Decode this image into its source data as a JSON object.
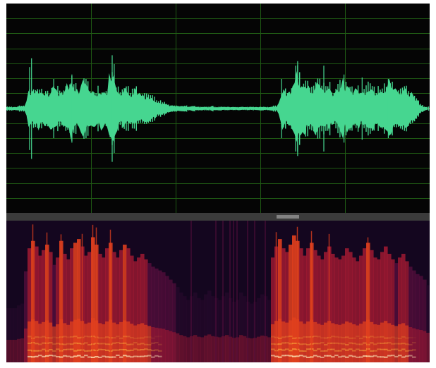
{
  "waveform": {
    "background_color": "#050505",
    "grid_color": "#1f5a14",
    "wave_color": "#46d690",
    "baseline_color": "#c8574a",
    "grid": true,
    "vertical_grid_divisions": 5,
    "horizontal_grid_divisions": 13,
    "envelope": [
      0.02,
      0.02,
      0.02,
      0.02,
      0.02,
      0.02,
      0.03,
      0.03,
      0.03,
      0.03,
      0.12,
      0.2,
      0.22,
      0.2,
      0.21,
      0.22,
      0.24,
      0.22,
      0.2,
      0.21,
      0.22,
      0.2,
      0.24,
      0.3,
      0.26,
      0.22,
      0.2,
      0.22,
      0.24,
      0.22,
      0.28,
      0.26,
      0.36,
      0.3,
      0.26,
      0.24,
      0.22,
      0.26,
      0.32,
      0.3,
      0.3,
      0.26,
      0.24,
      0.22,
      0.2,
      0.22,
      0.2,
      0.24,
      0.22,
      0.2,
      0.22,
      0.4,
      0.48,
      0.4,
      0.3,
      0.26,
      0.24,
      0.22,
      0.22,
      0.24,
      0.22,
      0.2,
      0.2,
      0.22,
      0.24,
      0.22,
      0.2,
      0.18,
      0.18,
      0.16,
      0.16,
      0.14,
      0.13,
      0.12,
      0.11,
      0.1,
      0.09,
      0.08,
      0.07,
      0.06,
      0.05,
      0.04,
      0.04,
      0.03,
      0.03,
      0.03,
      0.03,
      0.03,
      0.03,
      0.03,
      0.02,
      0.02,
      0.03,
      0.03,
      0.02,
      0.02,
      0.02,
      0.02,
      0.02,
      0.02,
      0.02,
      0.02,
      0.03,
      0.02,
      0.02,
      0.02,
      0.02,
      0.02,
      0.02,
      0.02,
      0.02,
      0.02,
      0.02,
      0.02,
      0.02,
      0.02,
      0.02,
      0.02,
      0.02,
      0.02,
      0.02,
      0.02,
      0.02,
      0.02,
      0.02,
      0.02,
      0.02,
      0.02,
      0.02,
      0.02,
      0.02,
      0.02,
      0.03,
      0.03,
      0.02,
      0.06,
      0.16,
      0.26,
      0.2,
      0.18,
      0.22,
      0.24,
      0.26,
      0.34,
      0.48,
      0.4,
      0.3,
      0.26,
      0.3,
      0.28,
      0.26,
      0.24,
      0.26,
      0.28,
      0.3,
      0.32,
      0.28,
      0.26,
      0.24,
      0.24,
      0.26,
      0.24,
      0.22,
      0.22,
      0.24,
      0.28,
      0.3,
      0.34,
      0.28,
      0.26,
      0.24,
      0.22,
      0.24,
      0.26,
      0.24,
      0.22,
      0.2,
      0.2,
      0.24,
      0.28,
      0.3,
      0.26,
      0.24,
      0.22,
      0.24,
      0.26,
      0.28,
      0.26,
      0.24,
      0.3,
      0.34,
      0.3,
      0.26,
      0.24,
      0.22,
      0.2,
      0.24,
      0.26,
      0.24,
      0.22,
      0.2,
      0.2,
      0.18,
      0.14,
      0.1,
      0.06,
      0.04,
      0.03,
      0.02,
      0.02
    ],
    "spikes": [
      {
        "index": 11,
        "level": 0.56
      },
      {
        "index": 12,
        "level": 0.68
      },
      {
        "index": 23,
        "level": 0.4
      },
      {
        "index": 32,
        "level": 0.46
      },
      {
        "index": 52,
        "level": 0.72
      },
      {
        "index": 53,
        "level": 0.6
      },
      {
        "index": 136,
        "level": 0.4
      },
      {
        "index": 143,
        "level": 0.58
      },
      {
        "index": 144,
        "level": 0.64
      },
      {
        "index": 157,
        "level": 0.58
      },
      {
        "index": 167,
        "level": 0.46
      },
      {
        "index": 176,
        "level": 0.42
      },
      {
        "index": 189,
        "level": 0.4
      }
    ]
  },
  "spectrogram": {
    "colors": {
      "low": "#14061f",
      "mid_low": "#5a0f3f",
      "mid": "#a51a33",
      "mid_high": "#e2401e",
      "high": "#fbb13c",
      "peak": "#fff4c2"
    },
    "activity": [
      0.05,
      0.05,
      0.05,
      0.08,
      0.1,
      0.45,
      0.7,
      0.78,
      0.72,
      0.62,
      0.68,
      0.74,
      0.66,
      0.52,
      0.6,
      0.78,
      0.64,
      0.58,
      0.7,
      0.76,
      0.8,
      0.72,
      0.62,
      0.66,
      0.82,
      0.74,
      0.64,
      0.6,
      0.7,
      0.76,
      0.66,
      0.6,
      0.68,
      0.74,
      0.7,
      0.62,
      0.56,
      0.6,
      0.64,
      0.58,
      0.54,
      0.5,
      0.48,
      0.46,
      0.44,
      0.4,
      0.36,
      0.32,
      0.28,
      0.22,
      0.18,
      0.14,
      0.18,
      0.22,
      0.16,
      0.14,
      0.2,
      0.24,
      0.18,
      0.16,
      0.14,
      0.18,
      0.22,
      0.16,
      0.12,
      0.14,
      0.22,
      0.18,
      0.12,
      0.1,
      0.12,
      0.16,
      0.2,
      0.18,
      0.14,
      0.6,
      0.72,
      0.8,
      0.7,
      0.66,
      0.74,
      0.84,
      0.78,
      0.7,
      0.62,
      0.7,
      0.76,
      0.68,
      0.62,
      0.58,
      0.66,
      0.72,
      0.64,
      0.6,
      0.58,
      0.62,
      0.7,
      0.66,
      0.6,
      0.56,
      0.62,
      0.7,
      0.76,
      0.68,
      0.6,
      0.58,
      0.66,
      0.72,
      0.64,
      0.58,
      0.54,
      0.6,
      0.64,
      0.56,
      0.5,
      0.46,
      0.42,
      0.4,
      0.36,
      0.3
    ]
  }
}
